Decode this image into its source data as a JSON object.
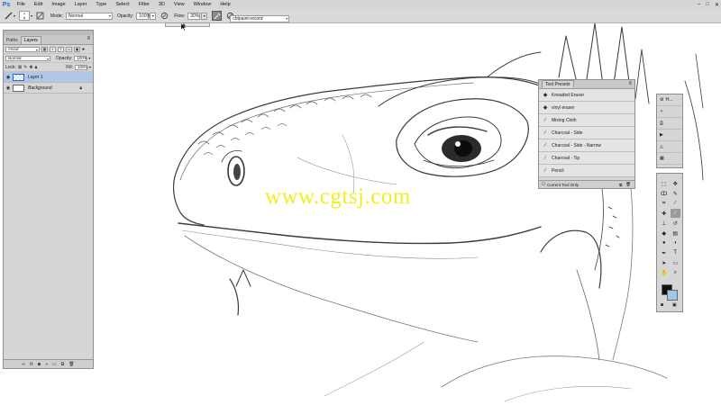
{
  "app": {
    "logo": "Ps"
  },
  "menu": [
    "File",
    "Edit",
    "Image",
    "Layer",
    "Type",
    "Select",
    "Filter",
    "3D",
    "View",
    "Window",
    "Help"
  ],
  "window_controls": {
    "minimize": "–",
    "maximize": "□",
    "close": "✕"
  },
  "options_bar": {
    "brush_size": "6",
    "mode_label": "Mode:",
    "mode_value": "Normal",
    "opacity_label": "Opacity:",
    "opacity_value": "100%",
    "flow_label": "Flow:",
    "flow_value": "30%",
    "workspace": "cbtpaint-record"
  },
  "layers_panel": {
    "tabs": [
      "Paths",
      "Layers"
    ],
    "active_tab": "Layers",
    "filter_label": "Kind",
    "blend_mode": "Normal",
    "opacity_label": "Opacity:",
    "opacity_value": "100%",
    "lock_label": "Lock:",
    "fill_label": "Fill:",
    "fill_value": "100%",
    "layers": [
      {
        "name": "Layer 1",
        "selected": true
      },
      {
        "name": "Background",
        "selected": false,
        "locked": true
      }
    ],
    "bottom_icons": [
      "link-icon",
      "fx-icon",
      "mask-icon",
      "adjustment-icon",
      "group-icon",
      "new-layer-icon",
      "trash-icon"
    ]
  },
  "tool_presets": {
    "title": "Tool Presets",
    "items": [
      "Kneaded Eraser",
      "vinyl eraser",
      "Mixing Cloth",
      "Charcoal - Side",
      "Charcoal - Side - Narrow",
      "Charcoal - Tip",
      "Pencil"
    ],
    "current_tool_only": "Current Tool Only"
  },
  "mini_dock": {
    "items": [
      "H...",
      "",
      ""
    ]
  },
  "watermark": "www.cgtsj.com",
  "colors": {
    "foreground": "#111111",
    "background": "#9fc8e8",
    "selection": "#b0c7e5",
    "watermark": "#f2ee1f"
  }
}
